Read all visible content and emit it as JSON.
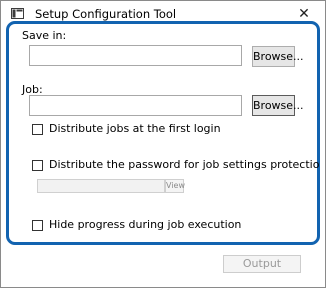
{
  "window": {
    "title": "Setup Configuration Tool",
    "close_glyph": "✕",
    "app_icon": "window-app-icon",
    "close_icon": "close-icon"
  },
  "form": {
    "save_in_label": "Save in:",
    "save_in_value": "",
    "save_in_browse": "Browse...",
    "job_label": "Job:",
    "job_value": "",
    "job_browse": "Browse...",
    "distribute_jobs_label": "Distribute jobs at the first login",
    "distribute_jobs_checked": false,
    "distribute_password_label": "Distribute the password for job settings protectio",
    "distribute_password_checked": false,
    "password_value": "",
    "view_label": "View",
    "hide_progress_label": "Hide progress during job execution",
    "hide_progress_checked": false
  },
  "footer": {
    "output_label": "Output"
  },
  "colors": {
    "highlight_border": "#1263b0",
    "button_face": "#e6e6e6",
    "disabled_text": "#9a9a9a"
  }
}
